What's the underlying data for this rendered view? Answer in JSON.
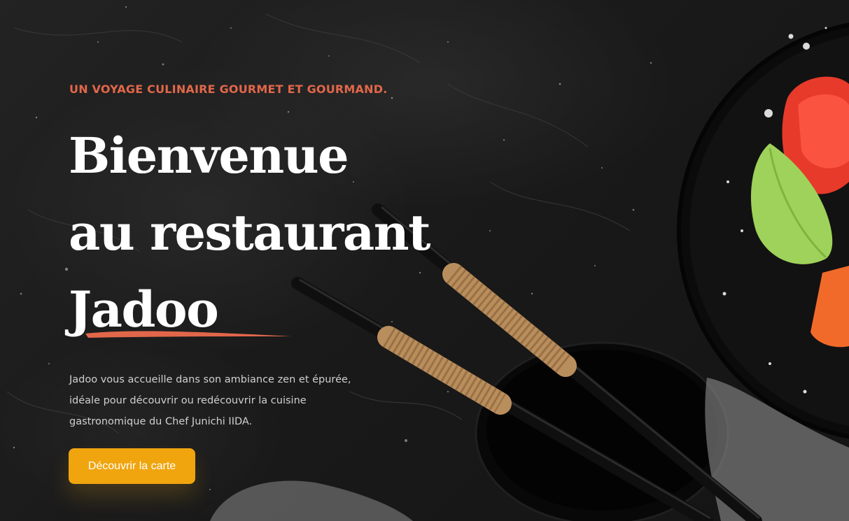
{
  "hero": {
    "eyebrow": "UN VOYAGE CULINAIRE GOURMET ET GOURMAND.",
    "title_line1": "Bienvenue",
    "title_line2": "au restaurant",
    "title_line3": "Jadoo",
    "description_lines": [
      "Jadoo vous accueille dans son ambiance zen et épurée,",
      "idéale pour découvrir ou redécouvrir la cuisine",
      "gastronomique du Chef Junichi IIDA."
    ],
    "cta_label": "Découvrir la carte"
  },
  "colors": {
    "accent": "#e2674a",
    "cta": "#f0a50e",
    "background": "#1a1a1a",
    "title": "#ffffff"
  }
}
